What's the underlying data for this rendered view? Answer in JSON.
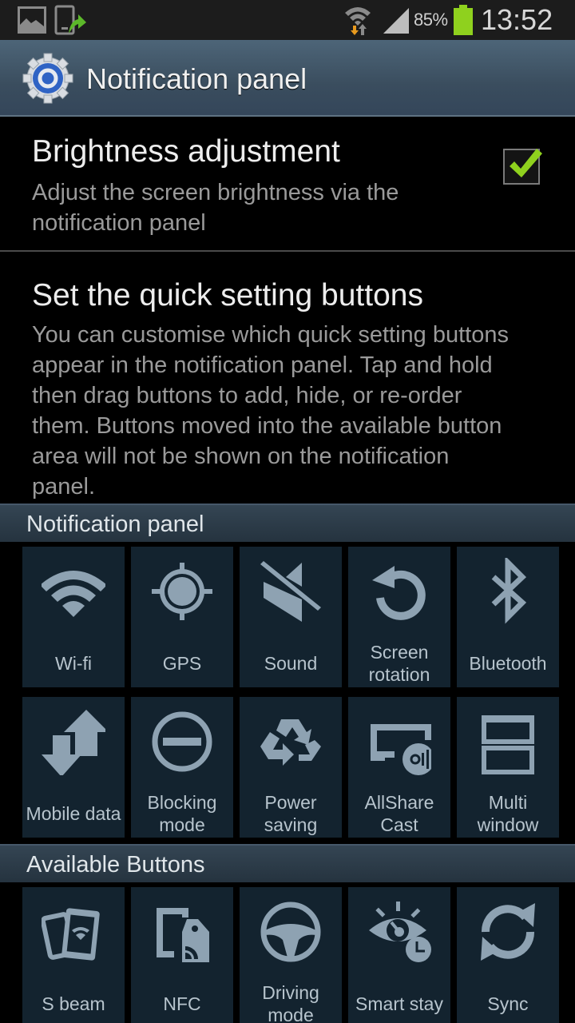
{
  "status_bar": {
    "notification_icons": [
      "gallery-icon",
      "upload-icon"
    ],
    "wifi": "wifi-icon",
    "signal": "signal-icon",
    "battery_percent": "85%",
    "battery_color": "#8fd11e",
    "time": "13:52"
  },
  "action_bar": {
    "icon": "settings-gear-icon",
    "title": "Notification panel"
  },
  "preferences": [
    {
      "title": "Brightness adjustment",
      "summary": "Adjust the screen brightness via the notification panel",
      "checked": true,
      "check_color": "#8fd11e"
    },
    {
      "title": "Set the quick setting buttons",
      "summary": "You can customise which quick setting buttons appear in the notification panel. Tap and hold then drag buttons to add, hide, or re-order them. Buttons moved into the available button area will not be shown on the notification panel."
    }
  ],
  "notification_panel_section": {
    "header": "Notification panel",
    "buttons": [
      {
        "label": "Wi-fi",
        "icon": "wifi-icon"
      },
      {
        "label": "GPS",
        "icon": "gps-icon"
      },
      {
        "label": "Sound",
        "icon": "sound-mute-icon"
      },
      {
        "label": "Screen rotation",
        "line1": "Screen",
        "line2": "rotation",
        "icon": "screen-rotation-icon"
      },
      {
        "label": "Bluetooth",
        "icon": "bluetooth-icon"
      },
      {
        "label": "Mobile data",
        "icon": "mobile-data-icon"
      },
      {
        "label": "Blocking mode",
        "line1": "Blocking",
        "line2": "mode",
        "icon": "blocking-mode-icon"
      },
      {
        "label": "Power saving",
        "line1": "Power",
        "line2": "saving",
        "icon": "power-saving-icon"
      },
      {
        "label": "AllShare Cast",
        "line1": "AllShare",
        "line2": "Cast",
        "icon": "allshare-cast-icon"
      },
      {
        "label": "Multi window",
        "line1": "Multi",
        "line2": "window",
        "icon": "multi-window-icon"
      }
    ]
  },
  "available_section": {
    "header": "Available Buttons",
    "buttons": [
      {
        "label": "S beam",
        "icon": "s-beam-icon"
      },
      {
        "label": "NFC",
        "icon": "nfc-icon"
      },
      {
        "label": "Driving mode",
        "line1": "Driving",
        "line2": "mode",
        "icon": "driving-mode-icon"
      },
      {
        "label": "Smart stay",
        "icon": "smart-stay-icon"
      },
      {
        "label": "Sync",
        "icon": "sync-icon"
      }
    ]
  },
  "colors": {
    "tile_bg": "#13232f",
    "icon_fill": "#8ea2b2",
    "tile_label": "#b7c4cd"
  }
}
